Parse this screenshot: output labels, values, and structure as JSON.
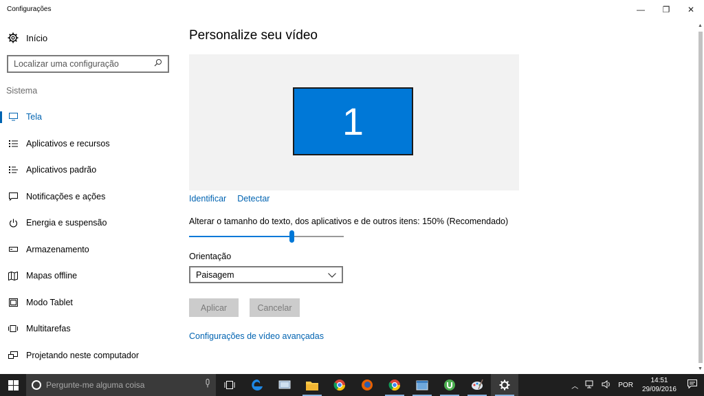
{
  "window": {
    "title": "Configurações",
    "minimize": "—",
    "maximize": "❐",
    "close": "✕"
  },
  "sidebar": {
    "home_label": "Início",
    "search_placeholder": "Localizar uma configuração",
    "section": "Sistema",
    "items": [
      {
        "label": "Tela",
        "icon": "monitor-icon",
        "active": true
      },
      {
        "label": "Aplicativos e recursos",
        "icon": "list-icon"
      },
      {
        "label": "Aplicativos padrão",
        "icon": "default-apps-icon"
      },
      {
        "label": "Notificações e ações",
        "icon": "notification-icon"
      },
      {
        "label": "Energia e suspensão",
        "icon": "power-icon"
      },
      {
        "label": "Armazenamento",
        "icon": "storage-icon"
      },
      {
        "label": "Mapas offline",
        "icon": "map-icon"
      },
      {
        "label": "Modo Tablet",
        "icon": "tablet-icon"
      },
      {
        "label": "Multitarefas",
        "icon": "multitask-icon"
      },
      {
        "label": "Projetando neste computador",
        "icon": "project-icon"
      }
    ]
  },
  "main": {
    "title": "Personalize seu vídeo",
    "display_number": "1",
    "identify_link": "Identificar",
    "detect_link": "Detectar",
    "scale_label": "Alterar o tamanho do texto, dos aplicativos e de outros itens: 150% (Recomendado)",
    "scale_slider_fraction": 0.66,
    "orientation_label": "Orientação",
    "orientation_value": "Paisagem",
    "apply_button": "Aplicar",
    "cancel_button": "Cancelar",
    "advanced_link": "Configurações de vídeo avançadas"
  },
  "taskbar": {
    "search_placeholder": "Pergunte-me alguma coisa",
    "language": "POR",
    "time": "14:51",
    "date": "29/09/2016",
    "apps": [
      {
        "name": "task-view-icon",
        "running": false
      },
      {
        "name": "edge-icon",
        "running": false
      },
      {
        "name": "network-app-icon",
        "running": false
      },
      {
        "name": "file-explorer-icon",
        "running": true
      },
      {
        "name": "chrome-icon",
        "running": false
      },
      {
        "name": "firefox-icon",
        "running": false
      },
      {
        "name": "chrome-alt-icon",
        "running": true
      },
      {
        "name": "app-window-icon",
        "running": true
      },
      {
        "name": "utorrent-icon",
        "running": true
      },
      {
        "name": "paint-icon",
        "running": true
      },
      {
        "name": "settings-icon",
        "running": true,
        "current": true
      }
    ]
  },
  "colors": {
    "accent": "#0078d7",
    "link": "#0063b1",
    "taskbar": "#1f1f1f"
  }
}
